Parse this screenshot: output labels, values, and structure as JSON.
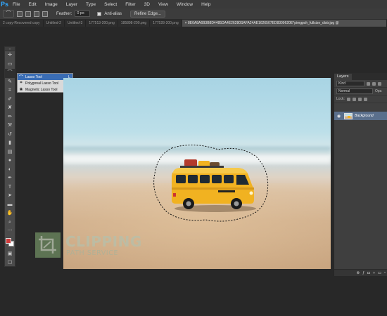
{
  "app": {
    "logo": "Ps",
    "menu": [
      "File",
      "Edit",
      "Image",
      "Layer",
      "Type",
      "Select",
      "Filter",
      "3D",
      "View",
      "Window",
      "Help"
    ]
  },
  "options": {
    "tool_icon": "lasso-icon",
    "feather_label": "Feather:",
    "feather_value": "0 px",
    "antialias_label": "Anti-alias",
    "refine_edge_label": "Refine Edge..."
  },
  "tabs": [
    {
      "label": "2 copy-Recovered copy"
    },
    {
      "label": "Untitled-2"
    },
    {
      "label": "Untitled-3"
    },
    {
      "label": "177513-200.png"
    },
    {
      "label": "185898-200.png"
    },
    {
      "label": "177528-200.png"
    },
    {
      "label": "× 8E0A8A6B3B8D4485DA4E26280SAFA24AE1626507ED8309620E*pimgpsh_fullsize_distr.jpg @"
    }
  ],
  "toolbox": {
    "grip": "››",
    "tools": [
      {
        "name": "move-tool-icon",
        "glyph": "✛"
      },
      {
        "name": "marquee-tool-icon",
        "glyph": "▭"
      },
      {
        "name": "lasso-tool-icon",
        "glyph": "⌒"
      },
      {
        "name": "quick-select-tool-icon",
        "glyph": "✎"
      },
      {
        "name": "crop-tool-icon",
        "glyph": "⌗"
      },
      {
        "name": "eyedropper-tool-icon",
        "glyph": "✐"
      },
      {
        "name": "healing-tool-icon",
        "glyph": "✘"
      },
      {
        "name": "brush-tool-icon",
        "glyph": "✏"
      },
      {
        "name": "clone-stamp-tool-icon",
        "glyph": "⚒"
      },
      {
        "name": "history-brush-tool-icon",
        "glyph": "↺"
      },
      {
        "name": "eraser-tool-icon",
        "glyph": "▮"
      },
      {
        "name": "gradient-tool-icon",
        "glyph": "▤"
      },
      {
        "name": "blur-tool-icon",
        "glyph": "●"
      },
      {
        "name": "dodge-tool-icon",
        "glyph": "◐"
      },
      {
        "name": "pen-tool-icon",
        "glyph": "✒"
      },
      {
        "name": "type-tool-icon",
        "glyph": "T"
      },
      {
        "name": "path-select-tool-icon",
        "glyph": "➤"
      },
      {
        "name": "shape-tool-icon",
        "glyph": "▬"
      },
      {
        "name": "hand-tool-icon",
        "glyph": "✋"
      },
      {
        "name": "zoom-tool-icon",
        "glyph": "⌕"
      },
      {
        "name": "more-tools-icon",
        "glyph": "⋯"
      }
    ],
    "foreground_color": "#d03a3a",
    "background_color": "#ffffff",
    "quick-mask-icon": "▣",
    "screen-mode-icon": "▢"
  },
  "flyout": {
    "items": [
      {
        "label": "Lasso Tool",
        "key": "L",
        "icon": "lasso-icon",
        "glyph": "⌒"
      },
      {
        "label": "Polygonal Lasso Tool",
        "key": "L",
        "icon": "polygonal-lasso-icon",
        "glyph": "⌗"
      },
      {
        "label": "Magnetic Lasso Tool",
        "key": "L",
        "icon": "magnetic-lasso-icon",
        "glyph": "❀"
      }
    ]
  },
  "watermark": {
    "title": "CLIPPING",
    "subtitle": "PATH SERVICE"
  },
  "layers_panel": {
    "tab_label": "Layers",
    "kind_label": "Kind",
    "blend_mode": "Normal",
    "opacity_label": "Opa",
    "lock_label": "Lock:",
    "layer_name": "Background",
    "footer_icons": [
      "link-icon",
      "fx-icon",
      "mask-icon",
      "adjustment-icon",
      "folder-icon",
      "new-layer-icon"
    ]
  },
  "colors": {
    "selection_highlight": "#3a6db5",
    "bus_yellow": "#f1b221",
    "layer_highlight": "#5a6f8c"
  }
}
